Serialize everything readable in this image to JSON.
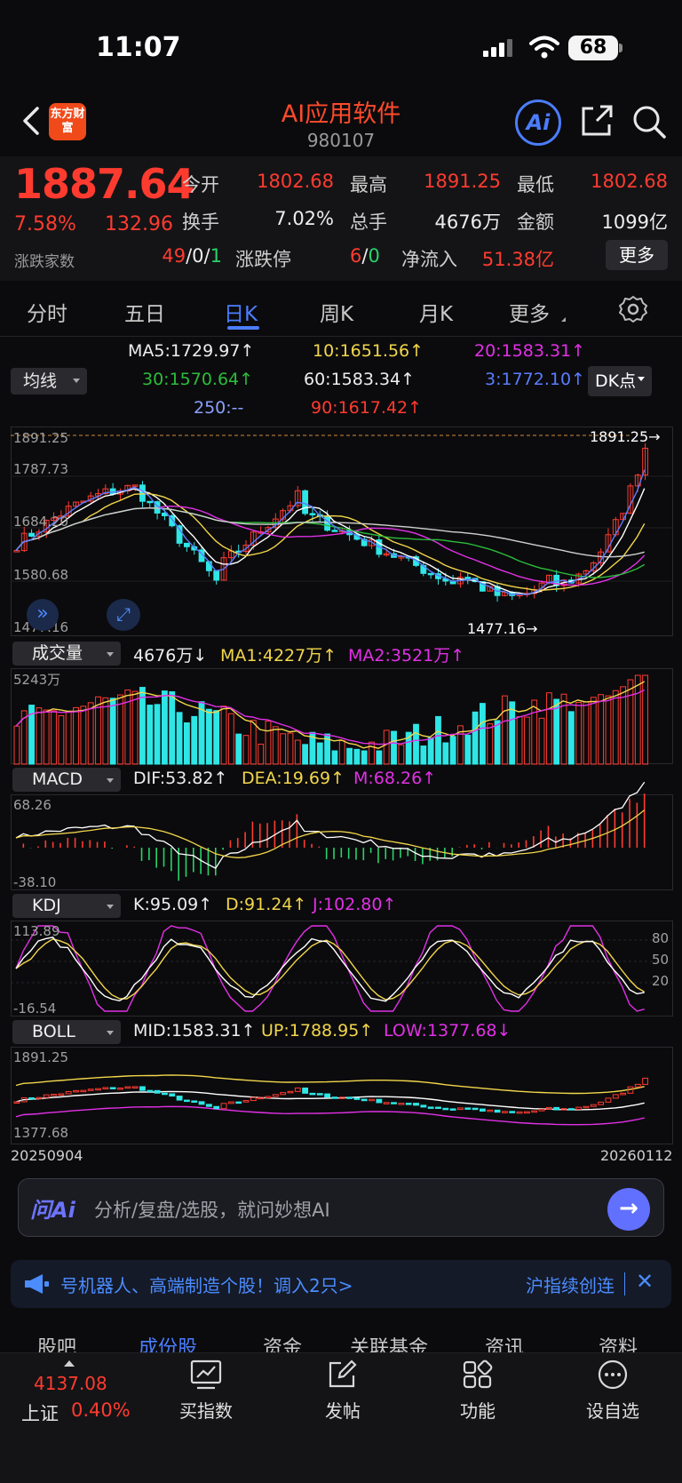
{
  "status": {
    "time": "11:07",
    "battery": "68"
  },
  "header": {
    "logo": "东方财富",
    "title": "AI应用软件",
    "code": "980107"
  },
  "quote": {
    "price": "1887.64",
    "pct": "7.58%",
    "change": "132.96",
    "breadth_label": "涨跌家数",
    "open_label": "今开",
    "open": "1802.68",
    "high_label": "最高",
    "high": "1891.25",
    "low_label": "最低",
    "low": "1802.68",
    "turnover_label": "换手",
    "turnover": "7.02%",
    "volume_label": "总手",
    "volume": "4676万",
    "amount_label": "金额",
    "amount": "1099亿",
    "breadth_up": "49",
    "breadth_sep1": "/",
    "breadth_flat": "0",
    "breadth_sep2": "/",
    "breadth_down": "1",
    "limit_label": "涨跌停",
    "limit_up": "6",
    "limit_sep": "/",
    "limit_down": "0",
    "netflow_label": "净流入",
    "netflow": "51.38亿",
    "more_label": "更多"
  },
  "tabs": [
    "分时",
    "五日",
    "日K",
    "周K",
    "月K",
    "更多"
  ],
  "active_tab": "日K",
  "ma_legend": {
    "select_label": "均线",
    "ma5": "MA5:1729.97↑",
    "ma10": "10:1651.56↑",
    "ma20": "20:1583.31↑",
    "ma30": "30:1570.64↑",
    "ma60": "60:1583.34↑",
    "ma3": "3:1772.10↑",
    "ma250": "250:--",
    "ma90": "90:1617.42↑",
    "dk_label": "DK点"
  },
  "kline": {
    "axis_top": "1891.25",
    "axis_2": "1787.73",
    "axis_3": "1684.20",
    "axis_4": "1580.68",
    "axis_bottom": "1477.16",
    "max_marker": "1891.25",
    "min_marker": "1477.16"
  },
  "volume": {
    "select_label": "成交量",
    "value": "4676万↓",
    "ma1": "MA1:4227万↑",
    "ma2": "MA2:3521万↑",
    "axis_top": "5243万"
  },
  "macd": {
    "select_label": "MACD",
    "dif": "DIF:53.82↑",
    "dea": "DEA:19.69↑",
    "m": "M:68.26↑",
    "axis_top": "68.26",
    "axis_bottom": "-38.10"
  },
  "kdj": {
    "select_label": "KDJ",
    "k": "K:95.09↑",
    "d": "D:91.24↑",
    "j": "J:102.80↑",
    "axis_top": "113.89",
    "axis_bottom": "-16.54",
    "level_80": "80",
    "level_50": "50",
    "level_20": "20"
  },
  "boll": {
    "select_label": "BOLL",
    "mid": "MID:1583.31↑",
    "up": "UP:1788.95↑",
    "low": "LOW:1377.68↓",
    "axis_top": "1891.25",
    "axis_bottom": "1377.68"
  },
  "dates": {
    "start": "20250904",
    "end": "20260112"
  },
  "ai_input": {
    "logo": "问Ai",
    "placeholder": "分析/复盘/选股，就问妙想AI"
  },
  "ticker": {
    "text": "号机器人、高端制造个股！调入2只>",
    "link": "沪指续创连",
    "close": "✕"
  },
  "section_tabs": [
    "股吧",
    "成份股",
    "资金",
    "关联基金",
    "资讯",
    "资料"
  ],
  "bottom_bar": {
    "index_value": "4137.08",
    "index_name": "上证",
    "index_pct": "0.40%",
    "items": [
      "买指数",
      "发帖",
      "功能",
      "设自选"
    ]
  },
  "colors": {
    "up": "#ff3b30",
    "down": "#2ee6e6",
    "accent": "#4b7dff",
    "ma5": "#ffffff",
    "ma10": "#f2d64b",
    "ma20": "#e230e6",
    "ma30": "#2bbd3b",
    "ma60": "#cfcfcf",
    "ma3": "#5b7cff"
  }
}
